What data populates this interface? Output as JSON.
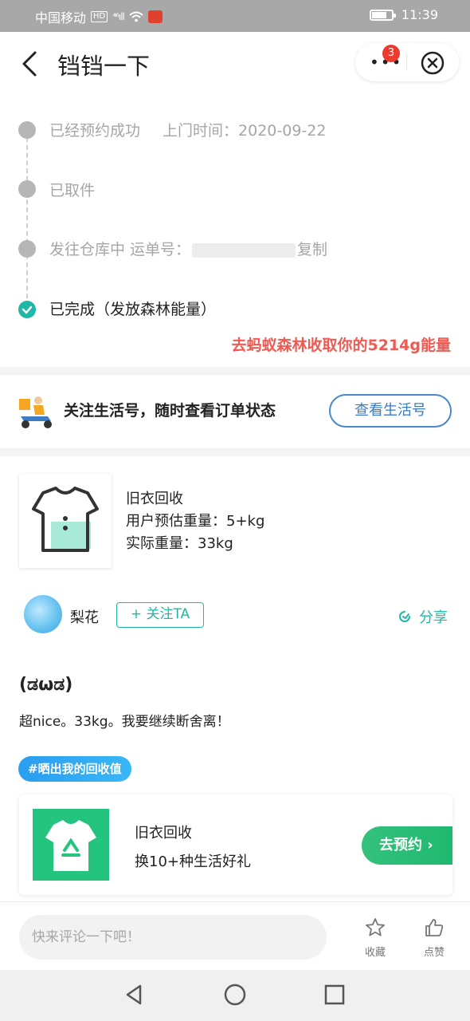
{
  "status_bar": {
    "carrier": "中国移动",
    "hd": "HD",
    "signal": "⁴⁶ıll",
    "time": "11:39"
  },
  "nav": {
    "title": "铛铛一下",
    "more_badge": "3"
  },
  "timeline": {
    "steps": [
      {
        "label": "已经预约成功",
        "extra": "上门时间：2020-09-22",
        "status": "done-past"
      },
      {
        "label": "已取件",
        "status": "done-past"
      },
      {
        "label": "发往仓库中 运单号：",
        "copy": "复制",
        "status": "done-past"
      },
      {
        "label": "已完成（发放森林能量）",
        "status": "current"
      }
    ],
    "energy_link": "去蚂蚁森林收取你的5214g能量"
  },
  "follow_banner": {
    "text": "关注生活号，随时查看订单状态",
    "button": "查看生活号"
  },
  "item": {
    "name": "旧衣回收",
    "estimated": "用户预估重量：5+kg",
    "actual": "实际重量：33kg"
  },
  "user": {
    "name": "梨花",
    "follow": "+ 关注TA",
    "share": "分享"
  },
  "post": {
    "title": "(ಡωಡ)",
    "body": "超nice。33kg。我要继续断舍离！",
    "tag": "#晒出我的回收值"
  },
  "promo": {
    "title": "旧衣回收",
    "subtitle": "换10+种生活好礼",
    "button": "去预约 ›"
  },
  "comment": {
    "placeholder": "快来评论一下吧！",
    "favorite": "收藏",
    "like": "点赞"
  },
  "colors": {
    "teal": "#1fb7a6",
    "red": "#f05a52",
    "blue": "#3b7cc2",
    "green": "#25c47e"
  }
}
